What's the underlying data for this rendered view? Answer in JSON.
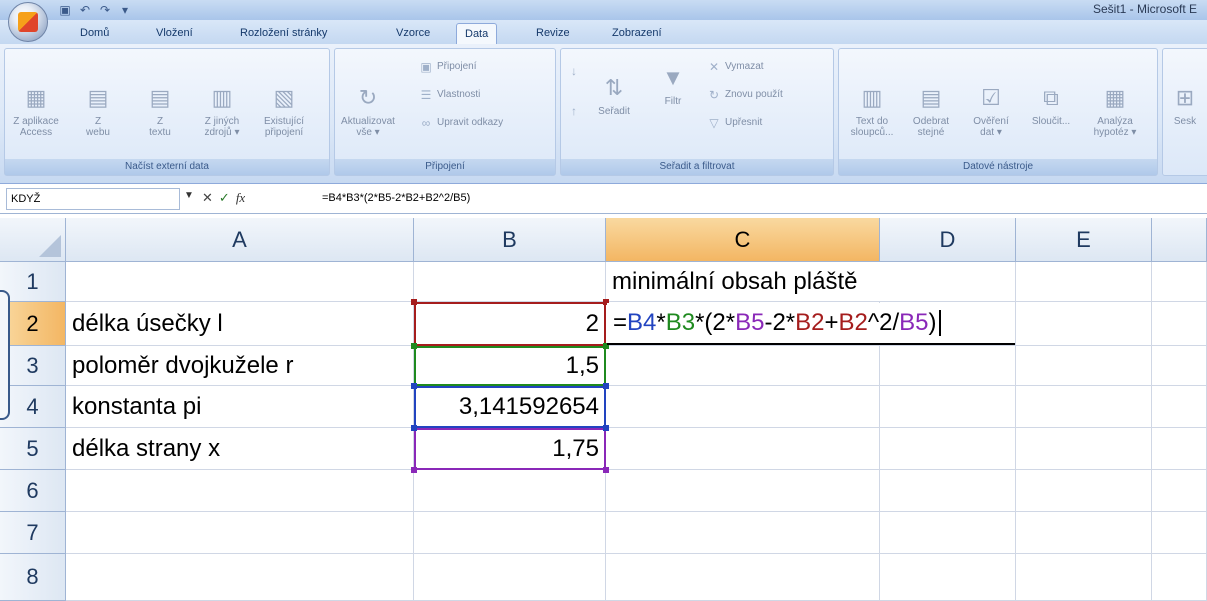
{
  "titlebar": {
    "title": "Sešit1 - Microsoft E"
  },
  "tabs": [
    {
      "label": "Domů"
    },
    {
      "label": "Vložení"
    },
    {
      "label": "Rozložení stránky"
    },
    {
      "label": "Vzorce"
    },
    {
      "label": "Data"
    },
    {
      "label": "Revize"
    },
    {
      "label": "Zobrazení"
    }
  ],
  "ribbon": {
    "groups": {
      "external": {
        "label": "Načíst externí data",
        "buttons": [
          {
            "line1": "Z aplikace",
            "line2": "Access"
          },
          {
            "line1": "Z",
            "line2": "webu"
          },
          {
            "line1": "Z",
            "line2": "textu"
          },
          {
            "line1": "Z jiných",
            "line2": "zdrojů ▾"
          },
          {
            "line1": "Existující",
            "line2": "připojení"
          }
        ]
      },
      "connections": {
        "label": "Připojení",
        "refresh": {
          "line1": "Aktualizovat",
          "line2": "vše ▾"
        },
        "small": [
          "Připojení",
          "Vlastnosti",
          "Upravit odkazy"
        ]
      },
      "sort": {
        "label": "Seřadit a filtrovat",
        "sort_btn": "Seřadit",
        "filter_btn": "Filtr",
        "small": [
          "Vymazat",
          "Znovu použít",
          "Upřesnit"
        ]
      },
      "tools": {
        "label": "Datové nástroje",
        "buttons": [
          {
            "line1": "Text do",
            "line2": "sloupců..."
          },
          {
            "line1": "Odebrat",
            "line2": "stejné"
          },
          {
            "line1": "Ověření",
            "line2": "dat ▾"
          },
          {
            "line1": "Sloučit...",
            "line2": ""
          },
          {
            "line1": "Analýza",
            "line2": "hypotéz ▾"
          }
        ]
      },
      "outline": {
        "first": "Sesk"
      }
    }
  },
  "formula_bar": {
    "name_box": "KDYŽ",
    "formula": "=B4*B3*(2*B5-2*B2+B2^2/B5)"
  },
  "grid": {
    "columns": [
      "A",
      "B",
      "C",
      "D",
      "E"
    ],
    "rows": [
      "1",
      "2",
      "3",
      "4",
      "5",
      "6",
      "7",
      "8"
    ],
    "cells": {
      "C1": "minimální obsah pláště",
      "A2": "délka úsečky l",
      "B2": "2",
      "A3": "poloměr dvojkužele r",
      "B3": "1,5",
      "A4": "konstanta pi",
      "B4": "3,141592654",
      "A5": "délka strany x",
      "B5": "1,75"
    },
    "editing_formula_parts": [
      {
        "text": "=",
        "color": "#000000"
      },
      {
        "text": "B4",
        "color": "#2244c0"
      },
      {
        "text": "*",
        "color": "#000000"
      },
      {
        "text": "B3",
        "color": "#1f8a1f"
      },
      {
        "text": "*(2*",
        "color": "#000000"
      },
      {
        "text": "B5",
        "color": "#8a28b8"
      },
      {
        "text": "-2*",
        "color": "#000000"
      },
      {
        "text": "B2",
        "color": "#a51d1d"
      },
      {
        "text": "+",
        "color": "#000000"
      },
      {
        "text": "B2",
        "color": "#a51d1d"
      },
      {
        "text": "^2/",
        "color": "#000000"
      },
      {
        "text": "B5",
        "color": "#8a28b8"
      },
      {
        "text": ")",
        "color": "#000000"
      }
    ]
  },
  "colors": {
    "ref_b2": "#a51d1d",
    "ref_b3": "#1f8a1f",
    "ref_b4": "#2244c0",
    "ref_b5": "#8a28b8",
    "selected_header": "#f3b663"
  }
}
